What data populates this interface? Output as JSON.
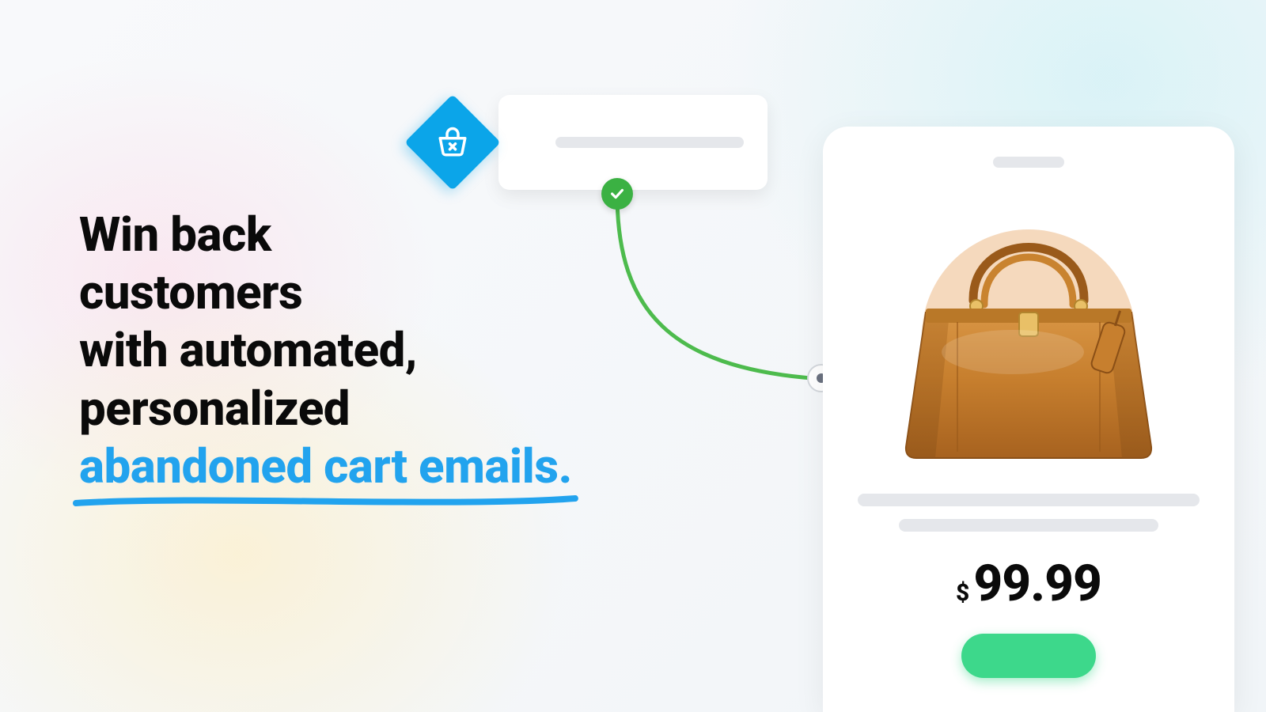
{
  "headline": {
    "line1": "Win back",
    "line2": "customers",
    "line3": "with automated,",
    "line4": "personalized",
    "highlight": "abandoned cart emails."
  },
  "product": {
    "currency": "$",
    "price": "99.99"
  },
  "colors": {
    "accent_blue": "#22a3ee",
    "badge_blue": "#0ba5e9",
    "success_green": "#3bb143",
    "cta_green": "#3dd88b",
    "connector_green": "#4dbb4d"
  }
}
